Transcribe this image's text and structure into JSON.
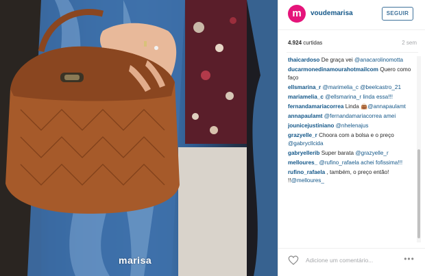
{
  "photo": {
    "watermark": "marisa"
  },
  "header": {
    "avatar_letter": "m",
    "username": "voudemarisa",
    "follow_label": "SEGUIR",
    "avatar_color": "#e5147a"
  },
  "stats": {
    "likes_count": "4.924",
    "likes_word": "curtidas",
    "time": "2 sem"
  },
  "comments": [
    {
      "user": "thaicardoso",
      "text": "De graça vei ",
      "mention": "@anacarolinomotta"
    },
    {
      "user": "ducarmonedinamourahotmailcom",
      "text": "Quero como faço",
      "mention": ""
    },
    {
      "user": "ellsmarina_r",
      "text": "",
      "mention": "@marimelia_c @beelcastro_21"
    },
    {
      "user": "mariamelia_c",
      "text": "",
      "mention": "@ellsmarina_r linda essa!!!"
    },
    {
      "user": "fernandamariacorrea",
      "text": "Linda 👜",
      "mention": "@annapaulamt"
    },
    {
      "user": "annapaulamt",
      "text": "",
      "mention": "@fernandamariacorrea amei"
    },
    {
      "user": "jounicejustiniano",
      "text": "",
      "mention": "@nhelenajus"
    },
    {
      "user": "grazyelle_r",
      "text": "Choora com a bolsa e o preço ",
      "mention": "@gabrycllcida"
    },
    {
      "user": "gabryellerib",
      "text": "Super barata ",
      "mention": "@grazyelle_r"
    },
    {
      "user": "melloures_",
      "text": "",
      "mention": "@rufino_rafaela achei fofissima!!!"
    },
    {
      "user": "rufino_rafaela",
      "text": ", também, o preço então! !!",
      "mention": "@melloures_"
    }
  ],
  "footer": {
    "comment_placeholder": "Adicione um comentário...",
    "more_label": "•••"
  }
}
